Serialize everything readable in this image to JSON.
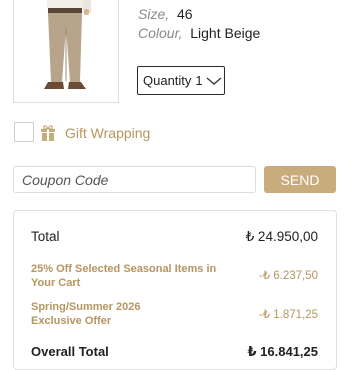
{
  "product": {
    "size_label": "Size,",
    "size_value": "46",
    "colour_label": "Colour,",
    "colour_value": "Light Beige",
    "quantity_label": "Quantity",
    "quantity_value": "1"
  },
  "gift": {
    "label": "Gift Wrapping"
  },
  "coupon": {
    "placeholder": "Coupon Code",
    "send_label": "SEND"
  },
  "summary": {
    "total_label": "Total",
    "total_value": "₺ 24.950,00",
    "discounts": [
      {
        "label": "25% Off Selected Seasonal Items in Your Cart",
        "value": "-₺ 6.237,50"
      },
      {
        "label": "Spring/Summer 2026 Exclusive Offer",
        "value": "-₺ 1.871,25"
      }
    ],
    "overall_label": "Overall Total",
    "overall_value": "₺ 16.841,25"
  },
  "colors": {
    "accent": "#c9ac7c",
    "accent_text": "#b69561",
    "border": "#dedede"
  }
}
